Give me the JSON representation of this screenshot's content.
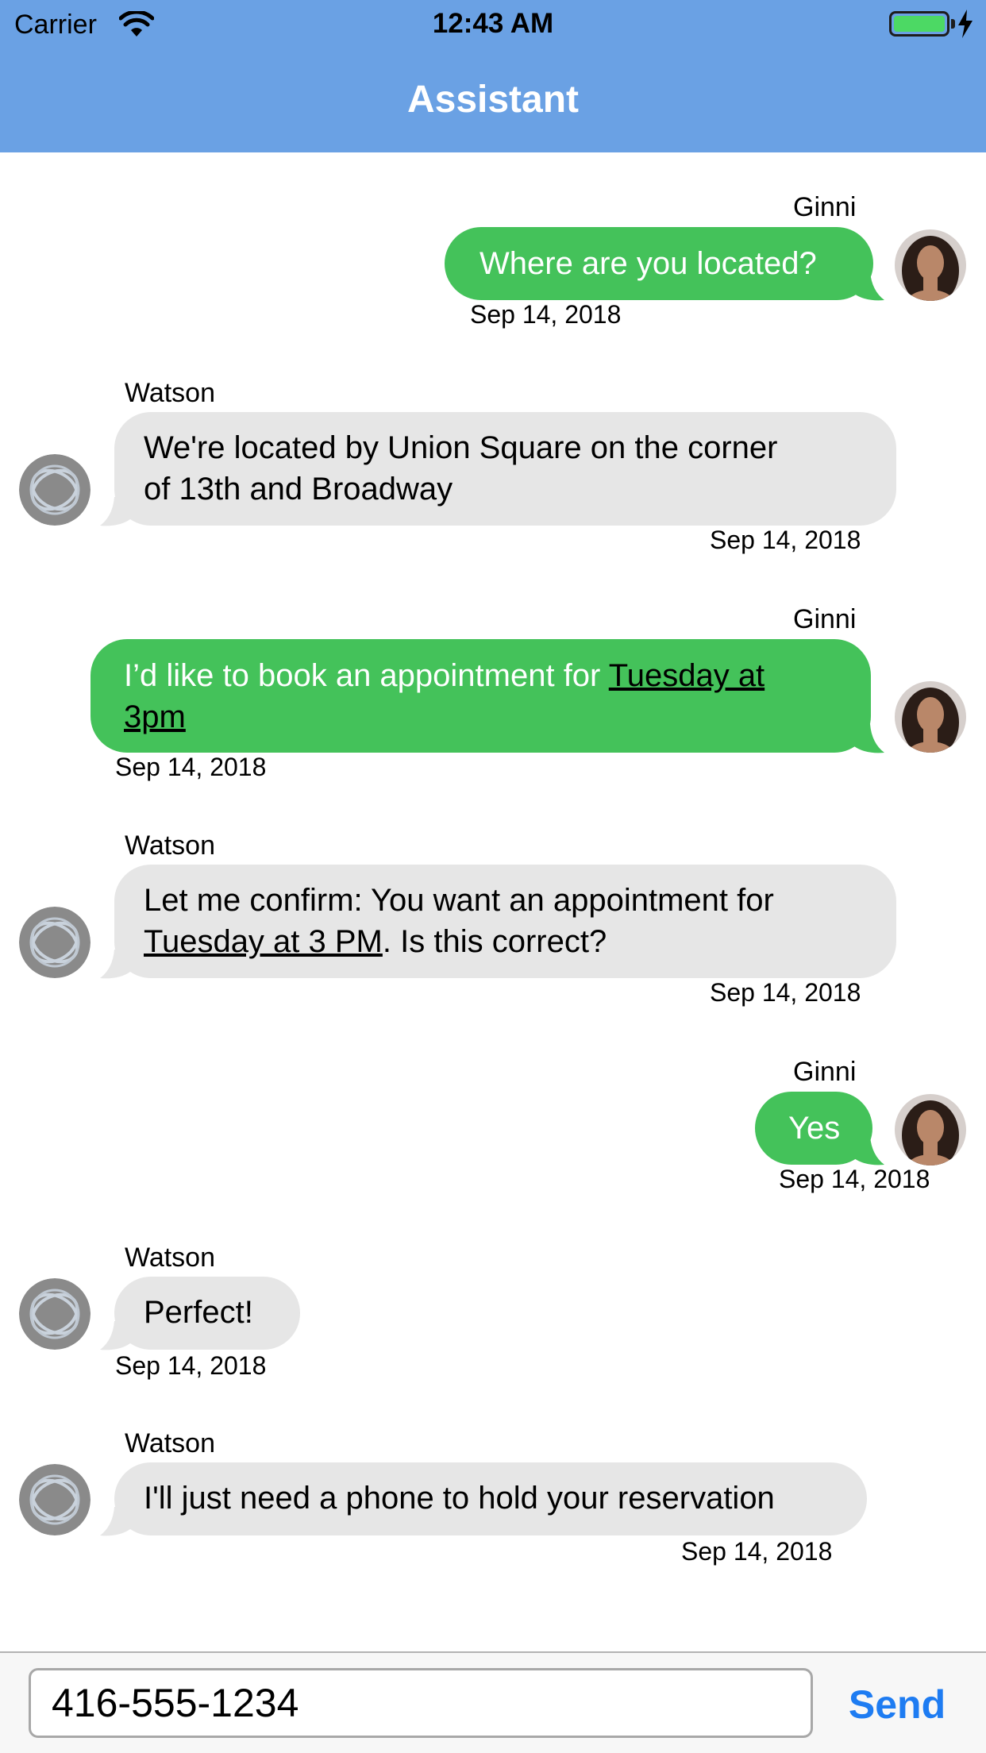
{
  "status_bar": {
    "carrier": "Carrier",
    "time": "12:43 AM",
    "battery_level": 1.0
  },
  "nav": {
    "title": "Assistant"
  },
  "messages": [
    {
      "sender": "Ginni",
      "from": "user",
      "text": "Where are you located?",
      "date": "Sep 14, 2018"
    },
    {
      "sender": "Watson",
      "from": "bot",
      "line1": "We're located by Union Square on the corner",
      "line2": "of 13th and Broadway",
      "date": "Sep 14, 2018"
    },
    {
      "sender": "Ginni",
      "from": "user",
      "text_before": "I’d like to book an appointment for ",
      "link_a": "Tuesday at",
      "link_b": "3pm",
      "date": "Sep 14, 2018"
    },
    {
      "sender": "Watson",
      "from": "bot",
      "line1": "Let me confirm: You want an appointment for",
      "link": "Tuesday at 3 PM",
      "text_after": ". Is this correct?",
      "date": "Sep 14, 2018"
    },
    {
      "sender": "Ginni",
      "from": "user",
      "text": "Yes",
      "date": "Sep 14, 2018"
    },
    {
      "sender": "Watson",
      "from": "bot",
      "text": "Perfect!",
      "date": "Sep 14, 2018"
    },
    {
      "sender": "Watson",
      "from": "bot",
      "text": "I'll just need a phone to hold your reservation",
      "date": "Sep 14, 2018"
    }
  ],
  "composer": {
    "value": "416-555-1234",
    "send_label": "Send"
  },
  "colors": {
    "header": "#6aa1e4",
    "user_bubble": "#44c25a",
    "bot_bubble": "#e6e6e6",
    "send": "#1e7cf2"
  },
  "icons": {
    "user_avatar": "user-avatar-photo",
    "bot_avatar": "watson-globe-icon"
  }
}
